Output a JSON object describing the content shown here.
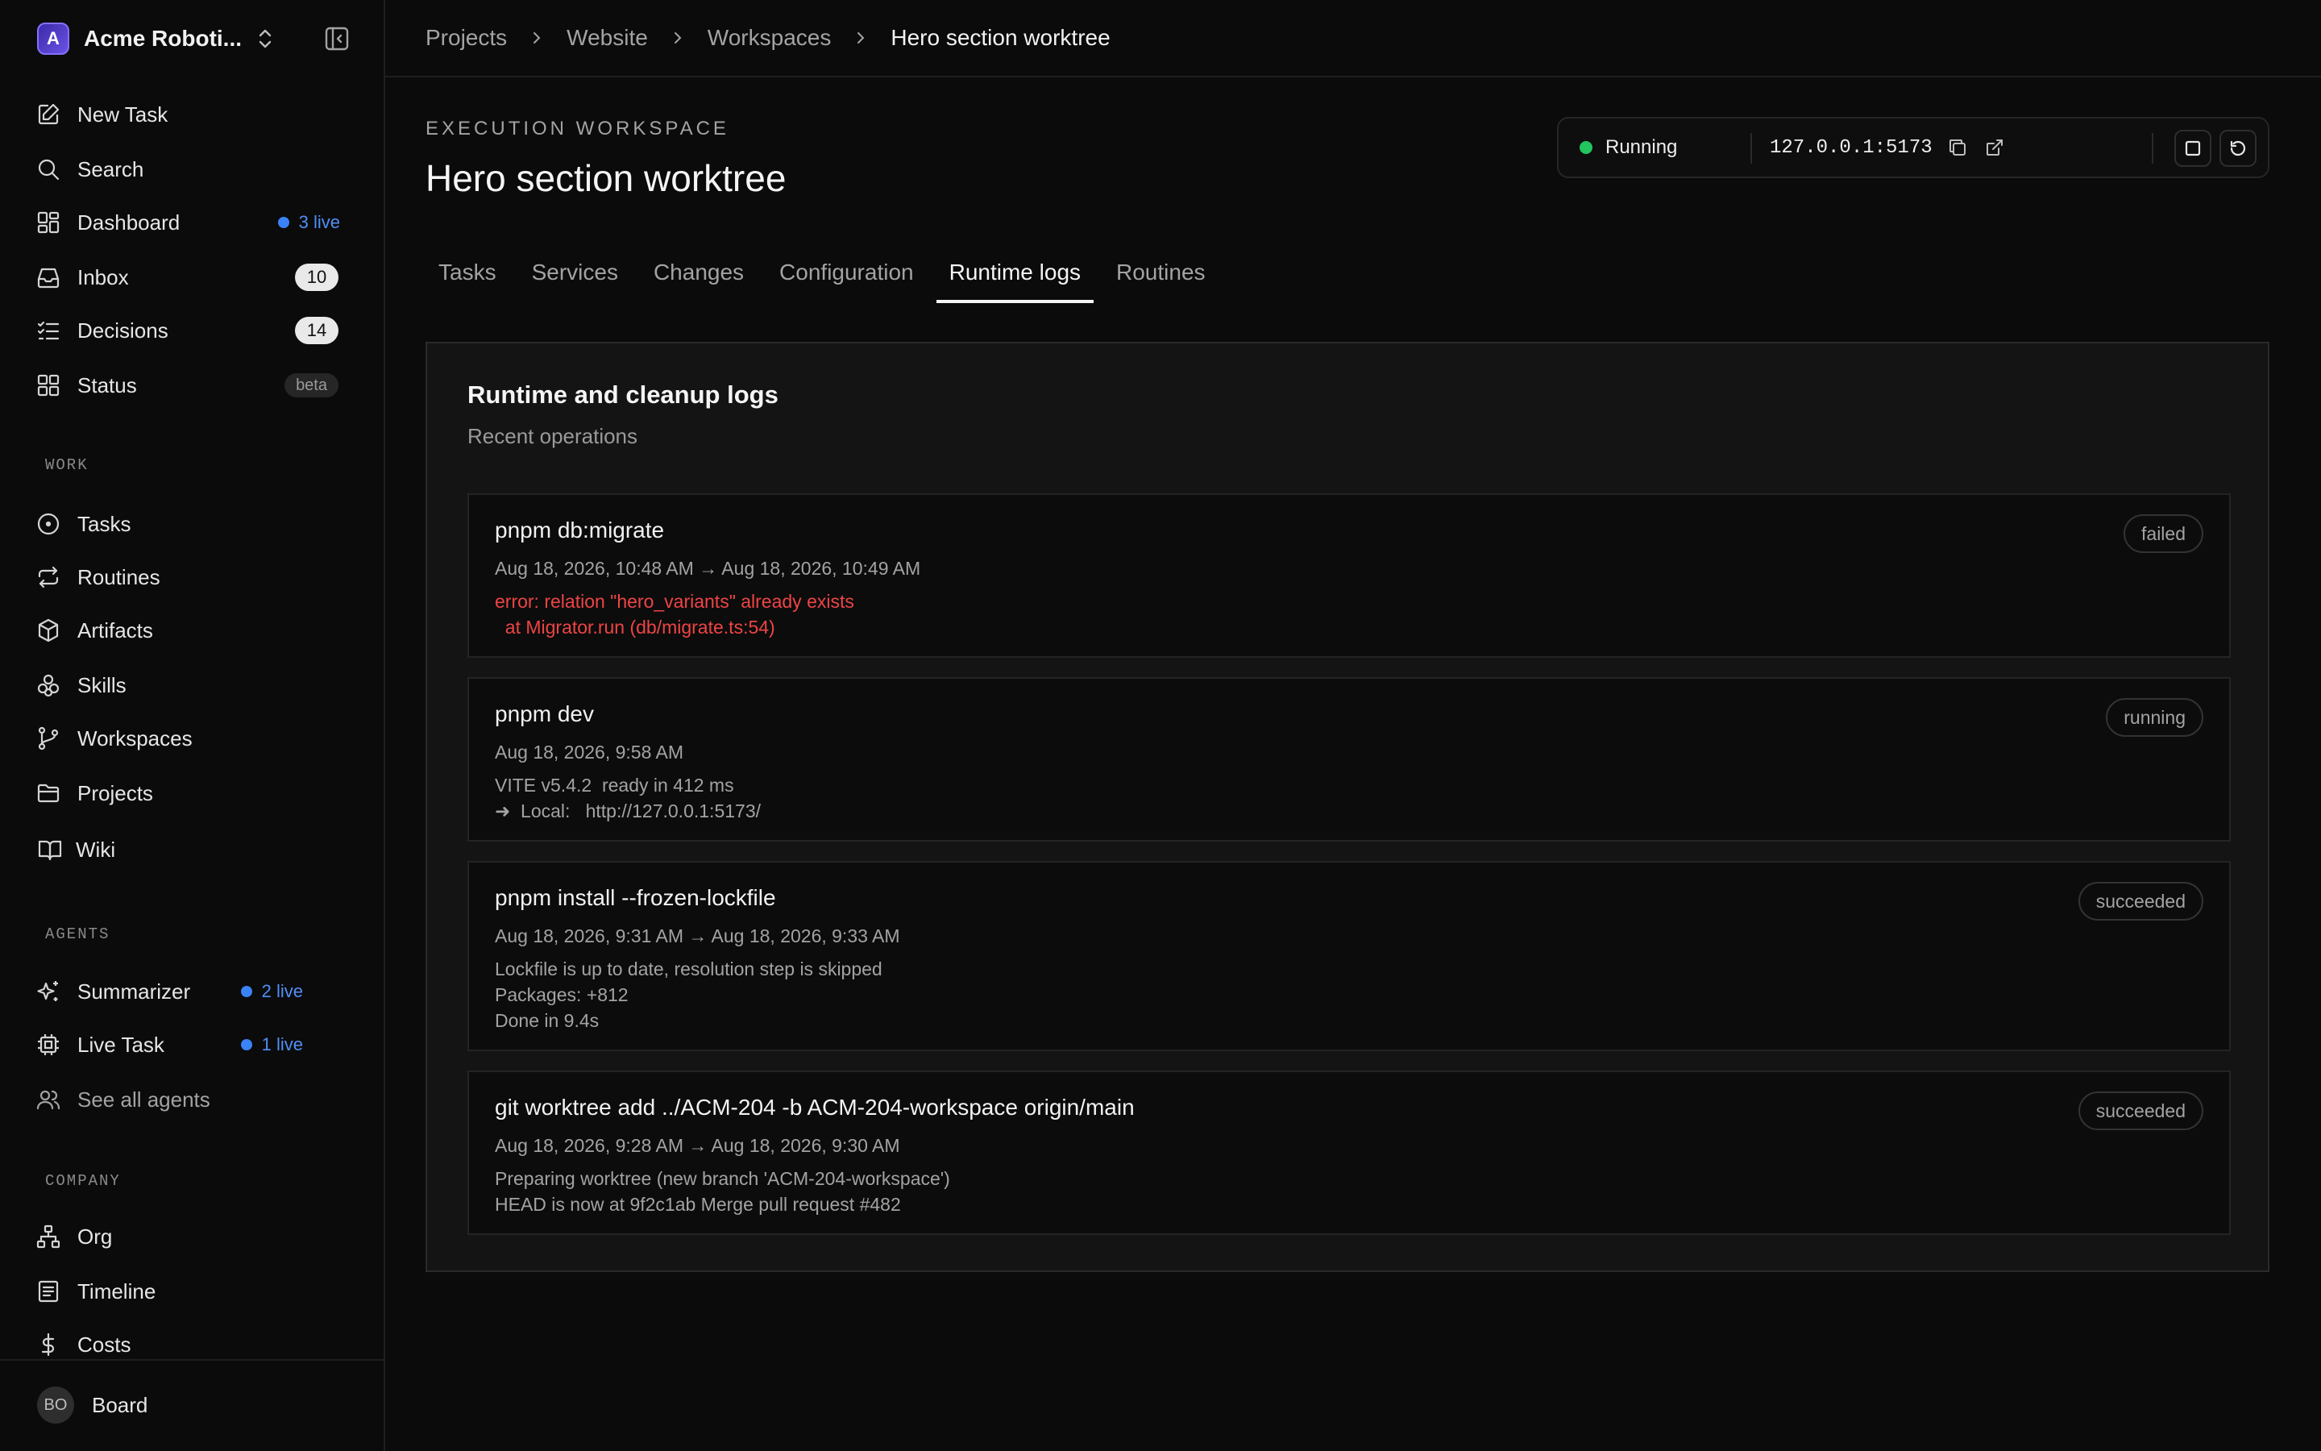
{
  "workspace": {
    "logo_letter": "A",
    "name": "Acme Roboti..."
  },
  "nav": {
    "new_task": "New Task",
    "search": "Search",
    "dashboard": "Dashboard",
    "dashboard_live": "3 live",
    "inbox": "Inbox",
    "inbox_count": "10",
    "decisions": "Decisions",
    "decisions_count": "14",
    "status": "Status",
    "status_badge": "beta"
  },
  "sections": {
    "work": "WORK",
    "agents": "AGENTS",
    "company": "COMPANY"
  },
  "work": {
    "tasks": "Tasks",
    "routines": "Routines",
    "artifacts": "Artifacts",
    "skills": "Skills",
    "workspaces": "Workspaces",
    "projects": "Projects",
    "wiki": "Wiki"
  },
  "agents": {
    "summarizer": "Summarizer",
    "summarizer_live": "2 live",
    "live_task": "Live Task",
    "live_task_live": "1 live",
    "see_all": "See all agents"
  },
  "company": {
    "org": "Org",
    "timeline": "Timeline",
    "costs": "Costs"
  },
  "user": {
    "initials": "BO",
    "name": "Board"
  },
  "breadcrumb": [
    "Projects",
    "Website",
    "Workspaces",
    "Hero section worktree"
  ],
  "header": {
    "eyebrow": "EXECUTION WORKSPACE",
    "title": "Hero section worktree"
  },
  "runtime": {
    "status": "Running",
    "status_color": "#22c55e",
    "url": "127.0.0.1:5173"
  },
  "tabs": [
    "Tasks",
    "Services",
    "Changes",
    "Configuration",
    "Runtime logs",
    "Routines"
  ],
  "active_tab": "Runtime logs",
  "panel": {
    "title": "Runtime and cleanup logs",
    "subtitle": "Recent operations"
  },
  "logs": [
    {
      "command": "pnpm db:migrate",
      "time": "Aug 18, 2026, 10:48 AM → Aug 18, 2026, 10:49 AM",
      "output": "error: relation \"hero_variants\" already exists\n  at Migrator.run (db/migrate.ts:54)",
      "status": "failed"
    },
    {
      "command": "pnpm dev",
      "time": "Aug 18, 2026, 9:58 AM",
      "output": "VITE v5.4.2  ready in 412 ms\n➜  Local:   http://127.0.0.1:5173/",
      "status": "running"
    },
    {
      "command": "pnpm install --frozen-lockfile",
      "time": "Aug 18, 2026, 9:31 AM → Aug 18, 2026, 9:33 AM",
      "output": "Lockfile is up to date, resolution step is skipped\nPackages: +812\nDone in 9.4s",
      "status": "succeeded"
    },
    {
      "command": "git worktree add ../ACM-204 -b ACM-204-workspace origin/main",
      "time": "Aug 18, 2026, 9:28 AM → Aug 18, 2026, 9:30 AM",
      "output": "Preparing worktree (new branch 'ACM-204-workspace')\nHEAD is now at 9f2c1ab Merge pull request #482",
      "status": "succeeded"
    }
  ],
  "colors": {
    "accent_live": "#3b82f6",
    "error": "#ef4444",
    "background": "#0b0b0b",
    "panel": "#141414"
  }
}
